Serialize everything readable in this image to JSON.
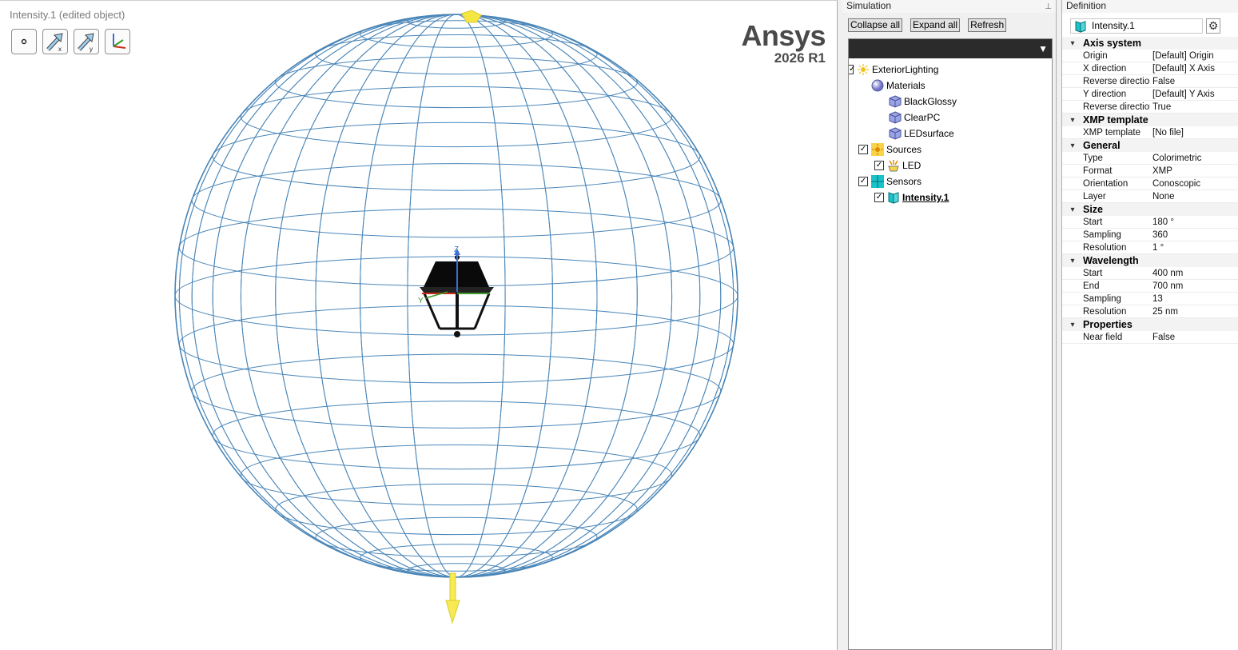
{
  "viewport": {
    "title": "Intensity.1 (edited object)",
    "logo_brand": "Ansys",
    "logo_version": "2026 R1",
    "tools": [
      "point-tool-icon",
      "x-axis-arrow-icon",
      "y-axis-arrow-icon",
      "axis-system-icon"
    ],
    "axis_labels": {
      "z": "Z",
      "y": "Y"
    }
  },
  "simulation": {
    "title": "Simulation",
    "buttons": {
      "collapse": "Collapse all",
      "expand": "Expand all",
      "refresh": "Refresh"
    },
    "tree": {
      "root": "ExteriorLighting",
      "materials": "Materials",
      "material_items": [
        "BlackGlossy",
        "ClearPC",
        "LEDsurface"
      ],
      "sources": "Sources",
      "source_items": [
        "LED"
      ],
      "sensors": "Sensors",
      "sensor_items": [
        "Intensity.1"
      ]
    }
  },
  "definition": {
    "title": "Definition",
    "name": "Intensity.1",
    "sections": [
      {
        "title": "Axis system",
        "rows": [
          {
            "label": "Origin",
            "value": "[Default] Origin"
          },
          {
            "label": "X direction",
            "value": "[Default] X Axis"
          },
          {
            "label": "Reverse direction",
            "value": "False"
          },
          {
            "label": "Y direction",
            "value": "[Default] Y Axis"
          },
          {
            "label": "Reverse direction",
            "value": "True"
          }
        ]
      },
      {
        "title": "XMP template",
        "rows": [
          {
            "label": "XMP template",
            "value": "[No file]"
          }
        ]
      },
      {
        "title": "General",
        "rows": [
          {
            "label": "Type",
            "value": "Colorimetric"
          },
          {
            "label": "Format",
            "value": "XMP"
          },
          {
            "label": "Orientation",
            "value": "Conoscopic"
          },
          {
            "label": "Layer",
            "value": "None"
          }
        ]
      },
      {
        "title": "Size",
        "rows": [
          {
            "label": "Start",
            "value": "180 °"
          },
          {
            "label": "Sampling",
            "value": "360"
          },
          {
            "label": "Resolution",
            "value": "1 °"
          }
        ]
      },
      {
        "title": "Wavelength",
        "rows": [
          {
            "label": "Start",
            "value": "400 nm"
          },
          {
            "label": "End",
            "value": "700 nm"
          },
          {
            "label": "Sampling",
            "value": "13"
          },
          {
            "label": "Resolution",
            "value": "25 nm"
          }
        ]
      },
      {
        "title": "Properties",
        "rows": [
          {
            "label": "Near field",
            "value": "False"
          }
        ]
      }
    ]
  },
  "colors": {
    "sphere": "#4a86b8",
    "arrow": "#f5e642",
    "selection_icon": "#19c3c9"
  }
}
